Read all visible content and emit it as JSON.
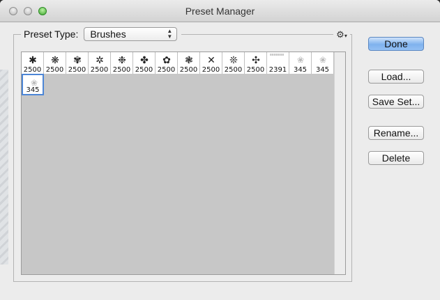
{
  "window": {
    "title": "Preset Manager"
  },
  "preset": {
    "label": "Preset Type:",
    "selected": "Brushes",
    "settings_icon": "gear-icon"
  },
  "presets": [
    {
      "count": "2500",
      "glyph": "✱",
      "style": "brush"
    },
    {
      "count": "2500",
      "glyph": "❋",
      "style": "brush"
    },
    {
      "count": "2500",
      "glyph": "✾",
      "style": "brush"
    },
    {
      "count": "2500",
      "glyph": "✲",
      "style": "brush"
    },
    {
      "count": "2500",
      "glyph": "❉",
      "style": "brush"
    },
    {
      "count": "2500",
      "glyph": "✤",
      "style": "brush"
    },
    {
      "count": "2500",
      "glyph": "✿",
      "style": "brush"
    },
    {
      "count": "2500",
      "glyph": "❃",
      "style": "brush"
    },
    {
      "count": "2500",
      "glyph": "✕",
      "style": "brush"
    },
    {
      "count": "2500",
      "glyph": "❊",
      "style": "brush"
    },
    {
      "count": "2500",
      "glyph": "✣",
      "style": "brush"
    },
    {
      "count": "2391",
      "glyph": "≡≡≡≡≡≡≡",
      "style": "text-doc"
    },
    {
      "count": "345",
      "glyph": "❀",
      "style": "faint"
    },
    {
      "count": "345",
      "glyph": "❀",
      "style": "faint"
    },
    {
      "count": "345",
      "glyph": "❀",
      "style": "faint"
    }
  ],
  "selected_index": 14,
  "buttons": {
    "done": "Done",
    "load": "Load...",
    "save_set": "Save Set...",
    "rename": "Rename...",
    "delete": "Delete"
  }
}
